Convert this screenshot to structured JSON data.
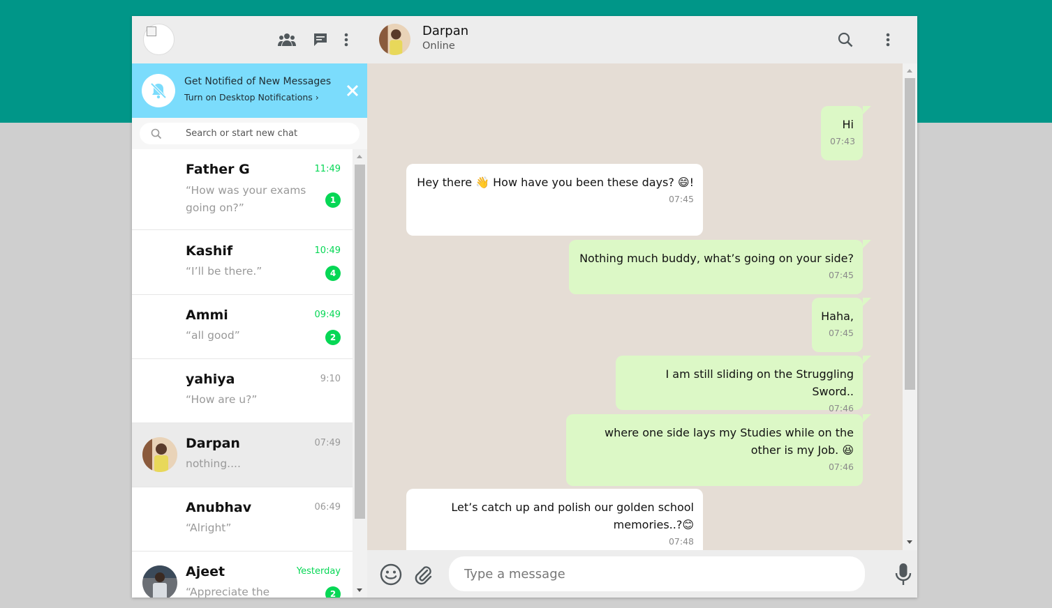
{
  "colors": {
    "accent_teal": "#009688",
    "notify_blue": "#7bdcfc",
    "unread_green": "#06d755",
    "out_bubble": "#dcf8c6",
    "chat_bg": "#e5ddd5"
  },
  "left_header": {
    "icons": [
      "community-icon",
      "new-chat-icon",
      "menu-icon"
    ]
  },
  "notification": {
    "title": "Get Notified of New Messages",
    "subtitle": "Turn on Desktop Notifications ›"
  },
  "search": {
    "placeholder": "Search or start new chat"
  },
  "chats": [
    {
      "name": "Father G",
      "time": "11:49",
      "message": "“How was your exams going on?”",
      "unread": "1",
      "time_color": "#06d755"
    },
    {
      "name": "Kashif",
      "time": "10:49",
      "message": "“I’ll be there.”",
      "unread": "4",
      "time_color": "#06d755"
    },
    {
      "name": "Ammi",
      "time": "09:49",
      "message": "“all good”",
      "unread": "2",
      "time_color": "#06d755"
    },
    {
      "name": "yahiya",
      "time": "9:10",
      "message": "“How are u?”",
      "unread": "",
      "time_color": "#999999"
    },
    {
      "name": "Darpan",
      "time": "07:49",
      "message": "nothing....",
      "unread": "",
      "time_color": "#999999"
    },
    {
      "name": "Anubhav",
      "time": "06:49",
      "message": "“Alright”",
      "unread": "",
      "time_color": "#999999"
    },
    {
      "name": "Ajeet",
      "time": "Yesterday",
      "message": "“Appreciate the mome..”",
      "unread": "2",
      "time_color": "#06d755"
    }
  ],
  "contact": {
    "name": "Darpan",
    "status": "Online"
  },
  "messages": [
    {
      "direction": "out",
      "text": "Hi",
      "time": "07:43"
    },
    {
      "direction": "in",
      "text": "Hey there 👋 How have you been these days? 😄!",
      "time": "07:45"
    },
    {
      "direction": "out",
      "text": "Nothing much buddy, what’s going on your side?",
      "time": "07:45"
    },
    {
      "direction": "out",
      "text": "Haha,",
      "time": "07:45"
    },
    {
      "direction": "out",
      "text": "I am still sliding on the Struggling Sword..",
      "time": "07:46"
    },
    {
      "direction": "out",
      "text": "where one side lays my Studies while on the other is my Job. 😆",
      "time": "07:46"
    },
    {
      "direction": "in",
      "text": "Let’s catch up and polish our golden school memories..?😊",
      "time": "07:48"
    }
  ],
  "composer": {
    "placeholder": "Type a message",
    "icons": [
      "emoji-icon",
      "attach-icon",
      "microphone-icon"
    ]
  }
}
